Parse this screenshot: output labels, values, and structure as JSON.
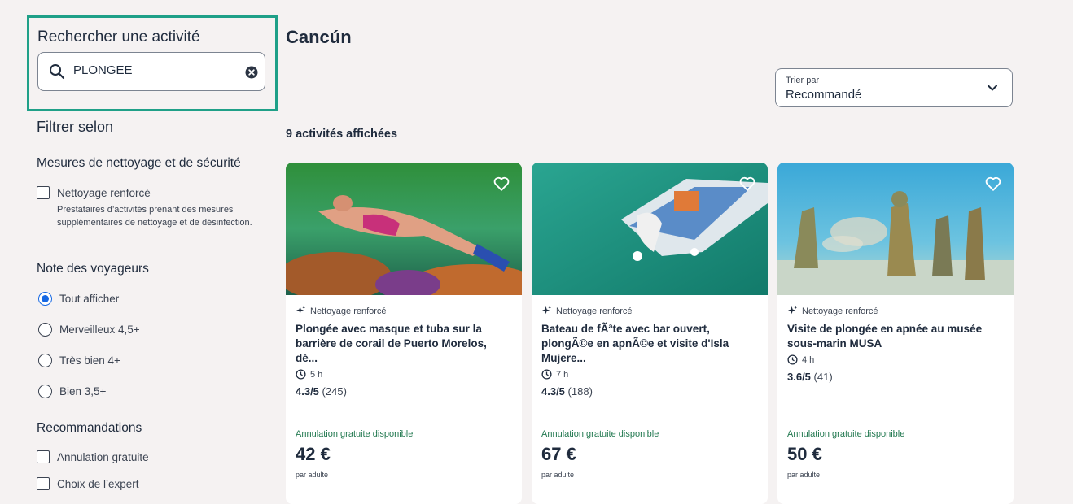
{
  "search": {
    "title": "Rechercher une activité",
    "value": "PLONGEE",
    "icon": "search-icon",
    "clear_icon": "clear-icon"
  },
  "filters": {
    "title": "Filtrer selon",
    "cleaning": {
      "title": "Mesures de nettoyage et de sécurité",
      "option": "Nettoyage renforcé",
      "description": "Prestataires d’activités prenant des mesures supplémentaires de nettoyage et de désinfection."
    },
    "rating": {
      "title": "Note des voyageurs",
      "options": [
        "Tout afficher",
        "Merveilleux 4,5+",
        "Très bien 4+",
        "Bien 3,5+"
      ],
      "selected": "Tout afficher"
    },
    "recommendations": {
      "title": "Recommandations",
      "options": [
        "Annulation gratuite",
        "Choix de l’expert"
      ]
    }
  },
  "main": {
    "city": "Cancún",
    "sort": {
      "label": "Trier par",
      "value": "Recommandé"
    },
    "count": "9 activités affichées"
  },
  "cards": [
    {
      "badge": "Nettoyage renforcé",
      "name": "Plongée avec masque et tuba sur la barrière de corail de Puerto Morelos, dé...",
      "duration": "5 h",
      "rating": "4.3/5",
      "reviews": "(245)",
      "cancellation": "Annulation gratuite disponible",
      "price": "42 €",
      "per": "par adulte"
    },
    {
      "badge": "Nettoyage renforcé",
      "name": "Bateau de fÃªte avec bar ouvert, plongÃ©e en apnÃ©e et visite d'Isla Mujere...",
      "duration": "7 h",
      "rating": "4.3/5",
      "reviews": "(188)",
      "cancellation": "Annulation gratuite disponible",
      "price": "67 €",
      "per": "par adulte"
    },
    {
      "badge": "Nettoyage renforcé",
      "name": "Visite de plongée en apnée au musée sous-marin MUSA",
      "duration": "4 h",
      "rating": "3.6/5",
      "reviews": "(41)",
      "cancellation": "Annulation gratuite disponible",
      "price": "50 €",
      "per": "par adulte"
    }
  ],
  "colors": {
    "accent": "#1668e3",
    "highlight_border": "#1fa088",
    "cancel_text": "#227950",
    "background": "#f5f2f2"
  }
}
